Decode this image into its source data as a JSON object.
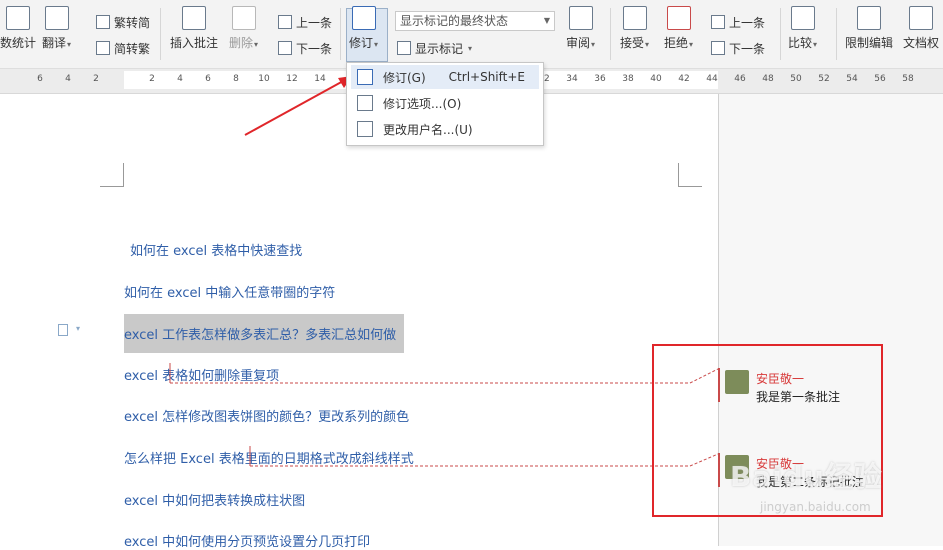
{
  "ribbon": {
    "word_count": "数统计",
    "translate": "翻译",
    "trad_simp": "繁转简",
    "simp_trad": "简转繁",
    "insert_comment": "插入批注",
    "delete": "删除",
    "prev": "上一条",
    "next": "下一条",
    "revise": "修订",
    "markup_select": "显示标记的最终状态",
    "show_markup": "显示标记",
    "review": "审阅",
    "accept": "接受",
    "reject": "拒绝",
    "prev2": "上一条",
    "next2": "下一条",
    "compare": "比较",
    "restrict": "限制编辑",
    "doc_perm": "文档权"
  },
  "ruler": {
    "ticks": [
      "6",
      "4",
      "2",
      "2",
      "4",
      "6",
      "8",
      "10",
      "12",
      "14",
      "32",
      "34",
      "36",
      "38",
      "40",
      "42",
      "44",
      "46",
      "48",
      "50",
      "52",
      "54",
      "56",
      "58"
    ]
  },
  "menu": {
    "items": [
      {
        "label": "修订(G)",
        "shortcut": "Ctrl+Shift+E"
      },
      {
        "label": "修订选项...(O)",
        "shortcut": ""
      },
      {
        "label": "更改用户名...(U)",
        "shortcut": ""
      }
    ]
  },
  "document": {
    "lines": [
      "如何在 excel 表格中快速查找",
      "如何在 excel 中输入任意带圈的字符",
      "excel 工作表怎样做多表汇总？多表汇总如何做",
      "excel 表格如何删除重复项",
      "excel 怎样修改图表饼图的颜色？更改系列的颜色",
      "怎么样把 Excel 表格里面的日期格式改成斜线样式",
      "excel 中如何把表转换成柱状图",
      "excel 中如何使用分页预览设置分几页打印"
    ]
  },
  "comments": [
    {
      "author": "安臣敬一",
      "text": "我是第一条批注"
    },
    {
      "author": "安臣敬一",
      "text": "我是第二条标记批注"
    }
  ],
  "watermark": {
    "main": "Baidu经验",
    "sub": "jingyan.baidu.com"
  },
  "colors": {
    "link": "#2f5ea8",
    "highlight": "#c9c9c9",
    "redbox": "#e0262a",
    "author": "#d83b3b"
  }
}
